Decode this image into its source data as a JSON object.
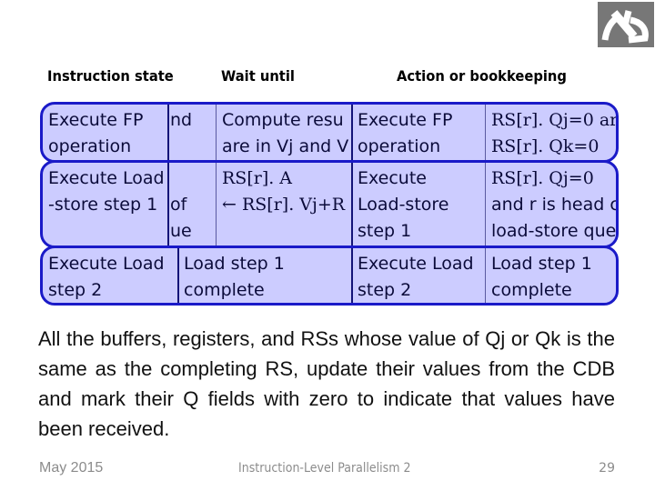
{
  "headers": {
    "col1": "Instruction state",
    "col2": "Wait until",
    "col3": "Action or bookkeeping"
  },
  "rows": [
    {
      "state": [
        "Execute FP",
        "operation"
      ],
      "hidden_frag": [
        "nd",
        ""
      ],
      "wait": [
        "Compute resu",
        "are in Vj and V"
      ],
      "action_state": [
        "Execute FP",
        "operation"
      ],
      "action": [
        "RS[r]. Qj=0 ar",
        "RS[r]. Qk=0"
      ]
    },
    {
      "state": [
        "Execute Load",
        "-store step 1",
        ""
      ],
      "hidden_frag": [
        "",
        "of",
        "ue"
      ],
      "wait": [
        "RS[r]. A",
        "← RS[r]. Vj+R",
        ""
      ],
      "action_state": [
        "Execute",
        "Load-store",
        "step 1"
      ],
      "action": [
        "RS[r]. Qj=0",
        "and r is head c",
        "load-store que"
      ]
    },
    {
      "state": [
        "Execute Load",
        "step 2"
      ],
      "wait": [
        "Load step 1",
        "complete"
      ],
      "action_state": [
        "Execute Load",
        "step 2"
      ],
      "action": [
        "Load step 1",
        "complete"
      ]
    }
  ],
  "body": "All the buffers, registers, and RSs whose value of Qj or Qk is the same as the completing RS, update their values from the CDB and mark their Q fields with zero to indicate that values have been received.",
  "footer": {
    "date": "May 2015",
    "title": "Instruction-Level Parallelism 2",
    "page": "29"
  },
  "logo": {
    "icon": "technion-logo-icon"
  }
}
